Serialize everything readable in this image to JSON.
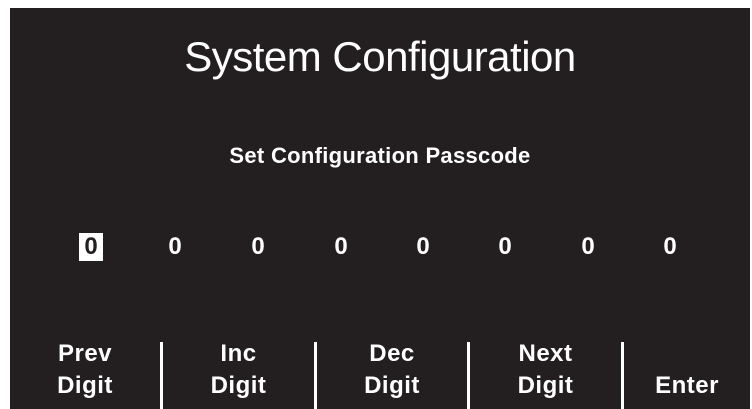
{
  "screen": {
    "title": "System Configuration",
    "subtitle": "Set Configuration Passcode",
    "selected_digit_index": 0
  },
  "passcode": {
    "digits": [
      "0",
      "0",
      "0",
      "0",
      "0",
      "0",
      "0",
      "0"
    ]
  },
  "softkeys": [
    {
      "line1": "Prev",
      "line2": "Digit"
    },
    {
      "line1": "Inc",
      "line2": "Digit"
    },
    {
      "line1": "Dec",
      "line2": "Digit"
    },
    {
      "line1": "Next",
      "line2": "Digit"
    },
    {
      "line1": "",
      "line2": "Enter"
    }
  ],
  "colors": {
    "background": "#231f20",
    "foreground": "#ffffff"
  }
}
